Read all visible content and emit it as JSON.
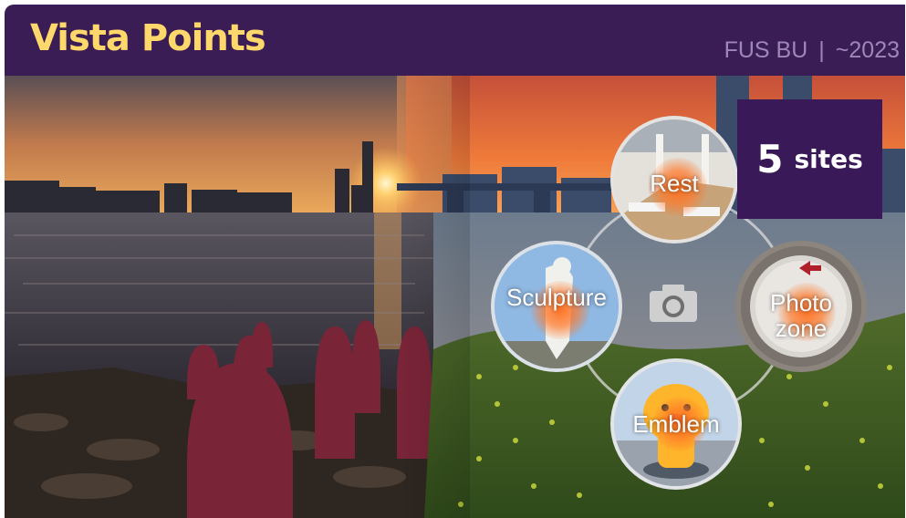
{
  "header": {
    "title": "Vista Points",
    "org": "FUS BU",
    "period": "~2023"
  },
  "count": {
    "number": "5",
    "unit": "sites"
  },
  "sites": [
    {
      "label": "Rest"
    },
    {
      "label": "Sculpture"
    },
    {
      "label": "Photo zone"
    },
    {
      "label": "Emblem"
    }
  ],
  "icons": {
    "center": "camera-icon"
  },
  "colors": {
    "header_bg": "#3b1d55",
    "title": "#ffd86b",
    "meta": "#9d86b8",
    "count_bg": "#3a1959"
  }
}
